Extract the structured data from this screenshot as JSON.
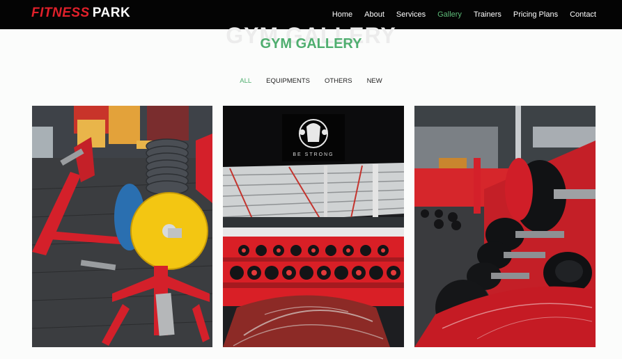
{
  "brand": {
    "part1": "FITNESS",
    "part2": "PARK"
  },
  "nav": {
    "items": [
      {
        "label": "Home"
      },
      {
        "label": "About"
      },
      {
        "label": "Services"
      },
      {
        "label": "Gallery"
      },
      {
        "label": "Trainers"
      },
      {
        "label": "Pricing Plans"
      },
      {
        "label": "Contact"
      }
    ],
    "active": "Gallery"
  },
  "gallery": {
    "bg_title": "GYM GALLERY",
    "title": "GYM GALLERY",
    "filters": [
      {
        "label": "ALL"
      },
      {
        "label": "EQUIPMENTS"
      },
      {
        "label": "OTHERS"
      },
      {
        "label": "NEW"
      }
    ],
    "active_filter": "ALL",
    "photos": [
      {
        "subject": "weight-plate-tree-photo"
      },
      {
        "subject": "dumbbell-rack-banner-photo",
        "banner_text": "BE STRONG"
      },
      {
        "subject": "dumbbell-rack-closeup-photo"
      }
    ]
  },
  "colors": {
    "accent": "#4fae6f",
    "brand_red": "#e0202a",
    "navbar": "#040404"
  }
}
